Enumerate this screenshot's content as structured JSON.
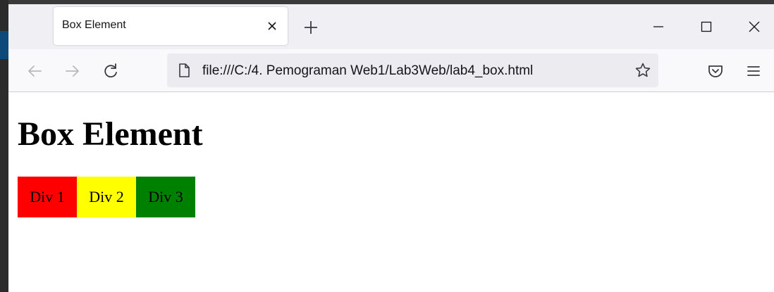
{
  "tab": {
    "title": "Box Element"
  },
  "address_bar": {
    "url": "file:///C:/4. Pemograman Web1/Lab3Web/lab4_box.html"
  },
  "page": {
    "heading": "Box Element",
    "boxes": [
      {
        "label": "Div 1",
        "color": "#ff0000"
      },
      {
        "label": "Div 2",
        "color": "#ffff00"
      },
      {
        "label": "Div 3",
        "color": "#008000"
      }
    ]
  },
  "icons": {
    "tab_close": "close-icon",
    "new_tab": "plus-icon",
    "minimize": "minimize-icon",
    "maximize": "maximize-icon",
    "close_window": "close-icon",
    "back": "arrow-left-icon",
    "forward": "arrow-right-icon",
    "reload": "reload-icon",
    "page": "page-icon",
    "bookmark": "star-icon",
    "pocket": "pocket-icon",
    "menu": "hamburger-menu-icon"
  }
}
